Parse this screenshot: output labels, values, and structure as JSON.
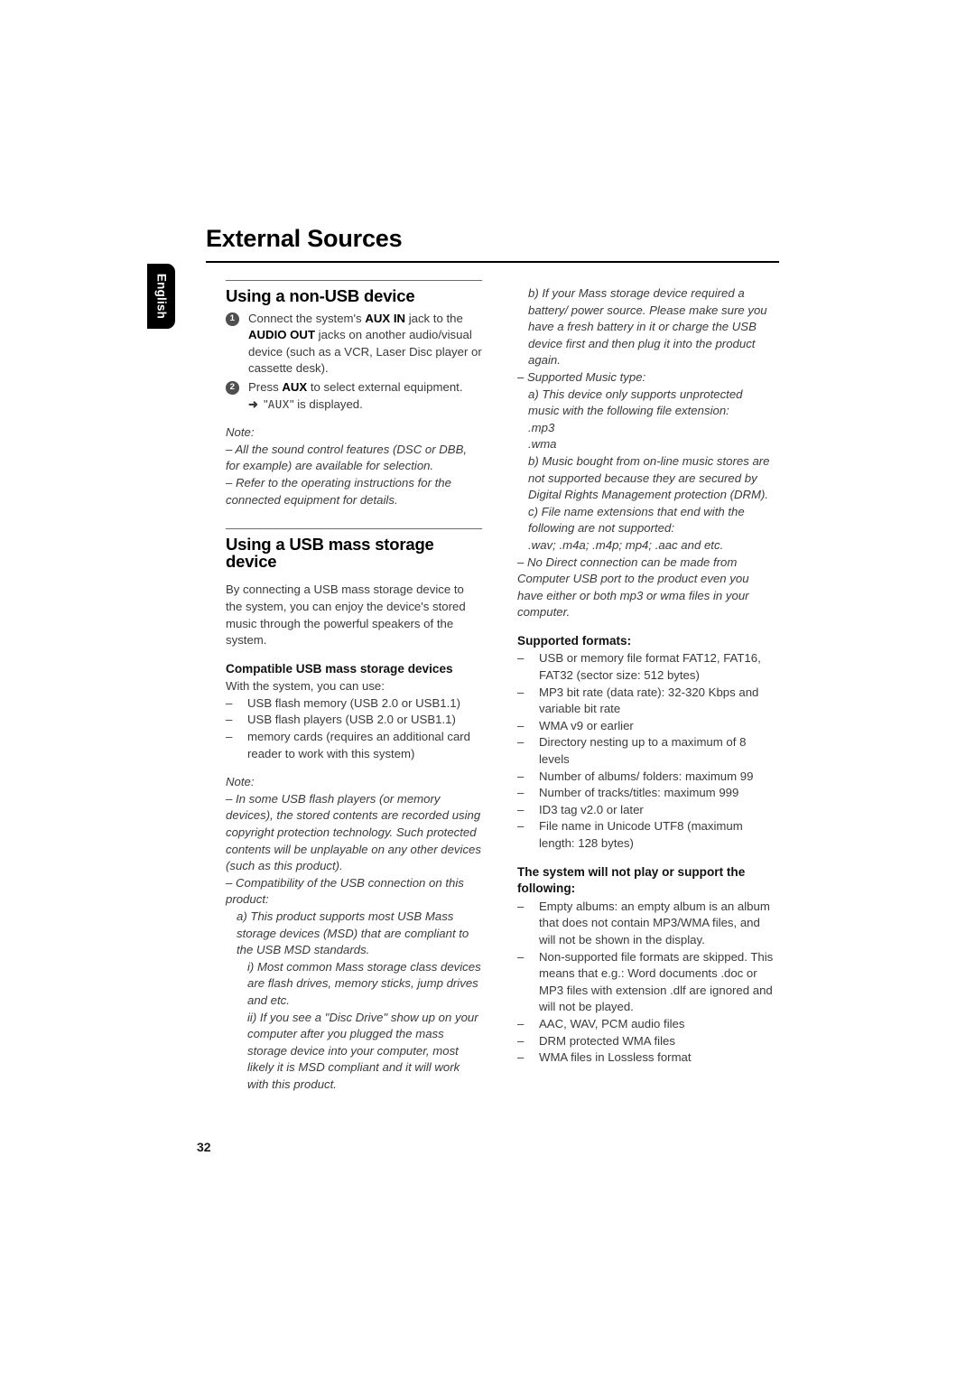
{
  "page": {
    "title": "External Sources",
    "language_tab": "English",
    "page_number": "32"
  },
  "left_column": {
    "section1": {
      "heading": "Using a non-USB device",
      "steps": [
        {
          "num": "1",
          "parts": [
            {
              "t": "Connect the system's ",
              "style": "normal"
            },
            {
              "t": "AUX IN",
              "style": "bold"
            },
            {
              "t": " jack to the ",
              "style": "normal"
            },
            {
              "t": "AUDIO OUT",
              "style": "bold"
            },
            {
              "t": " jacks on another audio/visual device (such as a VCR, Laser Disc player or cassette desk).",
              "style": "normal"
            }
          ]
        },
        {
          "num": "2",
          "parts": [
            {
              "t": "Press ",
              "style": "normal"
            },
            {
              "t": "AUX",
              "style": "bold"
            },
            {
              "t": " to select external equipment.",
              "style": "normal"
            }
          ],
          "arrow_line": {
            "arrow": "➜",
            "pre": "\"",
            "lcd": "AUX",
            "post": "\" is displayed."
          }
        }
      ],
      "note_label": "Note:",
      "notes": [
        "–  All the sound control features (DSC or DBB, for example) are available for selection.",
        "–  Refer to the operating instructions for the connected equipment for details."
      ]
    },
    "section2": {
      "heading": "Using a USB mass storage device",
      "intro": "By connecting a USB mass storage device to the system, you can enjoy the device's stored music through the powerful speakers of the system.",
      "sub_heading": "Compatible USB mass storage devices",
      "sub_intro": "With the system, you can use:",
      "devices": [
        "USB flash memory (USB 2.0 or USB1.1)",
        "USB flash players (USB 2.0 or USB1.1)",
        "memory cards (requires an additional card reader to work with this system)"
      ],
      "note_label": "Note:",
      "notes": [
        "–  In some USB flash players (or memory devices), the stored contents are recorded using copyright protection technology. Such protected contents will be unplayable on any other devices (such as this product).",
        "–  Compatibility of the USB connection on this product:"
      ],
      "sub_items": [
        {
          "indent": 1,
          "text": "a) This product supports most USB Mass storage devices (MSD) that are compliant to the USB MSD standards."
        },
        {
          "indent": 2,
          "text": "i) Most common Mass storage class devices are flash drives, memory sticks, jump drives and etc."
        },
        {
          "indent": 2,
          "text": "ii) If you see a \"Disc Drive\" show up on your computer after you plugged the mass storage device into your computer, most likely it is MSD compliant and it will work with this product."
        }
      ]
    }
  },
  "right_column": {
    "continuation": [
      {
        "indent": 1,
        "text": "b) If your Mass storage device required a battery/ power source. Please make sure you have a fresh battery in it or charge the USB device first and then plug it into the product again."
      },
      {
        "indent": 0,
        "text": "–  Supported Music type:"
      },
      {
        "indent": 1,
        "text": "a) This device only supports unprotected music with the following file extension:"
      },
      {
        "indent": 1,
        "text": ".mp3"
      },
      {
        "indent": 1,
        "text": ".wma"
      },
      {
        "indent": 1,
        "text": "b) Music bought from on-line music stores are not supported because they are secured by Digital Rights Management protection (DRM)."
      },
      {
        "indent": 1,
        "text": "c) File name extensions that end with the following are not supported:"
      },
      {
        "indent": 1,
        "text": ".wav; .m4a; .m4p; mp4; .aac and etc."
      },
      {
        "indent": 0,
        "text": "–  No Direct connection can be made from Computer USB port to the product even you have either or both mp3 or wma files in your computer."
      }
    ],
    "supported_formats": {
      "heading": "Supported formats:",
      "items": [
        "USB or memory file format FAT12, FAT16, FAT32 (sector size: 512 bytes)",
        "MP3 bit rate (data rate): 32-320 Kbps and variable bit rate",
        "WMA v9 or earlier",
        "Directory nesting up to a maximum of 8 levels",
        "Number of albums/ folders: maximum 99",
        "Number of tracks/titles: maximum 999",
        "ID3 tag v2.0 or later",
        "File name in Unicode UTF8 (maximum length: 128 bytes)"
      ]
    },
    "not_supported": {
      "heading": "The system will not play or support the following:",
      "items": [
        "Empty albums: an empty album is an album that does not contain MP3/WMA files, and will not be shown in the display.",
        "Non-supported file formats are skipped. This means that e.g.: Word documents .doc or MP3 files with extension .dlf are ignored and will not be played.",
        "AAC, WAV, PCM audio files",
        "DRM protected WMA files",
        "WMA files in Lossless format"
      ]
    }
  }
}
